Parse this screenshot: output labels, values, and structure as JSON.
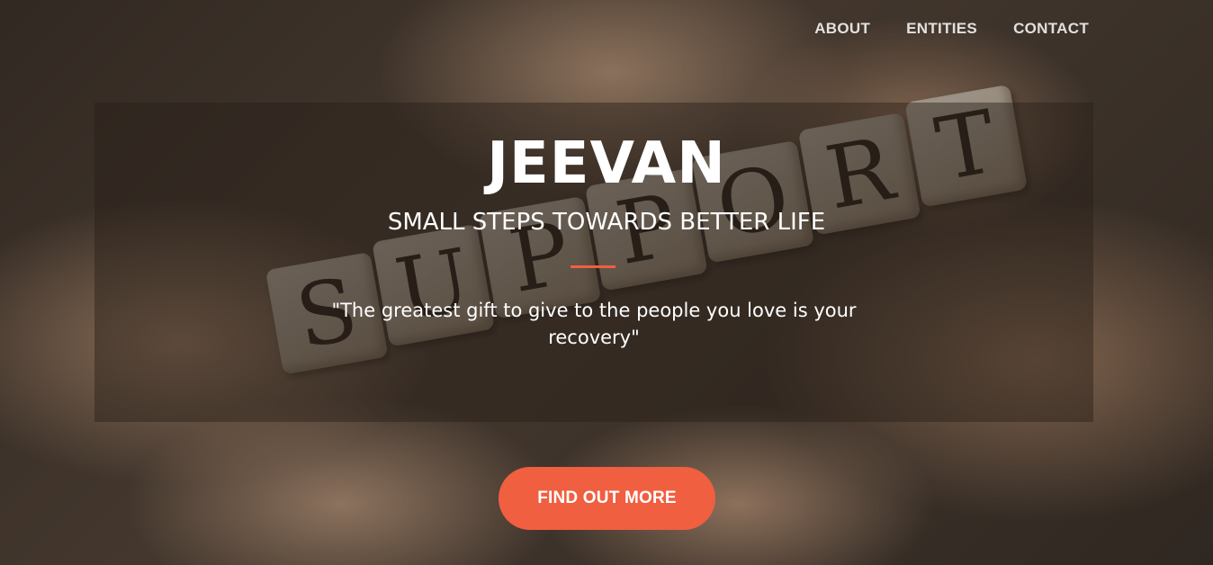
{
  "nav": {
    "items": [
      {
        "label": "ABOUT"
      },
      {
        "label": "ENTITIES"
      },
      {
        "label": "CONTACT"
      }
    ]
  },
  "hero": {
    "title": "JEEVAN",
    "subtitle": "SMALL STEPS TOWARDS BETTER LIFE",
    "quote": "\"The greatest gift to give to the people you love is your recovery\"",
    "cta_label": "FIND OUT MORE",
    "background_word": [
      "S",
      "U",
      "P",
      "P",
      "O",
      "R",
      "T"
    ]
  },
  "colors": {
    "accent": "#f05f40",
    "text": "#ffffff"
  }
}
